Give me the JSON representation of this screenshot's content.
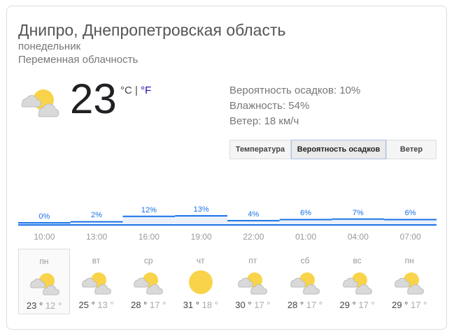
{
  "location": "Днипро, Днепропетровская область",
  "day": "понедельник",
  "condition": "Переменная облачность",
  "current": {
    "temp": "23",
    "unit_c": "°C",
    "separator": "|",
    "unit_f": "°F",
    "icon": "partly-cloudy-icon"
  },
  "details": {
    "precip": "Вероятность осадков: 10%",
    "humidity": "Влажность: 54%",
    "wind": "Ветер: 18 км/ч"
  },
  "tabs": {
    "temperature": "Температура",
    "precipitation": "Вероятность осадков",
    "wind": "Ветер",
    "selected": "precipitation"
  },
  "chart_data": {
    "type": "bar",
    "categories": [
      "10:00",
      "13:00",
      "16:00",
      "19:00",
      "22:00",
      "01:00",
      "04:00",
      "07:00"
    ],
    "values": [
      0,
      2,
      12,
      13,
      4,
      6,
      7,
      6
    ],
    "labels": [
      "0%",
      "2%",
      "12%",
      "13%",
      "4%",
      "6%",
      "7%",
      "6%"
    ],
    "color": "#1a73e8",
    "title": "",
    "xlabel": "",
    "ylabel": ""
  },
  "forecast": [
    {
      "day": "пн",
      "icon": "partly-cloudy-icon",
      "high": "23 °",
      "low": "12 °",
      "selected": true
    },
    {
      "day": "вт",
      "icon": "partly-cloudy-icon",
      "high": "25 °",
      "low": "13 °"
    },
    {
      "day": "ср",
      "icon": "partly-cloudy-icon",
      "high": "28 °",
      "low": "17 °"
    },
    {
      "day": "чт",
      "icon": "sun-icon",
      "high": "31 °",
      "low": "18 °"
    },
    {
      "day": "пт",
      "icon": "partly-cloudy-icon",
      "high": "30 °",
      "low": "17 °"
    },
    {
      "day": "сб",
      "icon": "partly-cloudy-icon",
      "high": "28 °",
      "low": "17 °"
    },
    {
      "day": "вс",
      "icon": "partly-cloudy-icon",
      "high": "29 °",
      "low": "17 °"
    },
    {
      "day": "пн",
      "icon": "partly-cloudy-icon",
      "high": "29 °",
      "low": "17 °"
    }
  ]
}
